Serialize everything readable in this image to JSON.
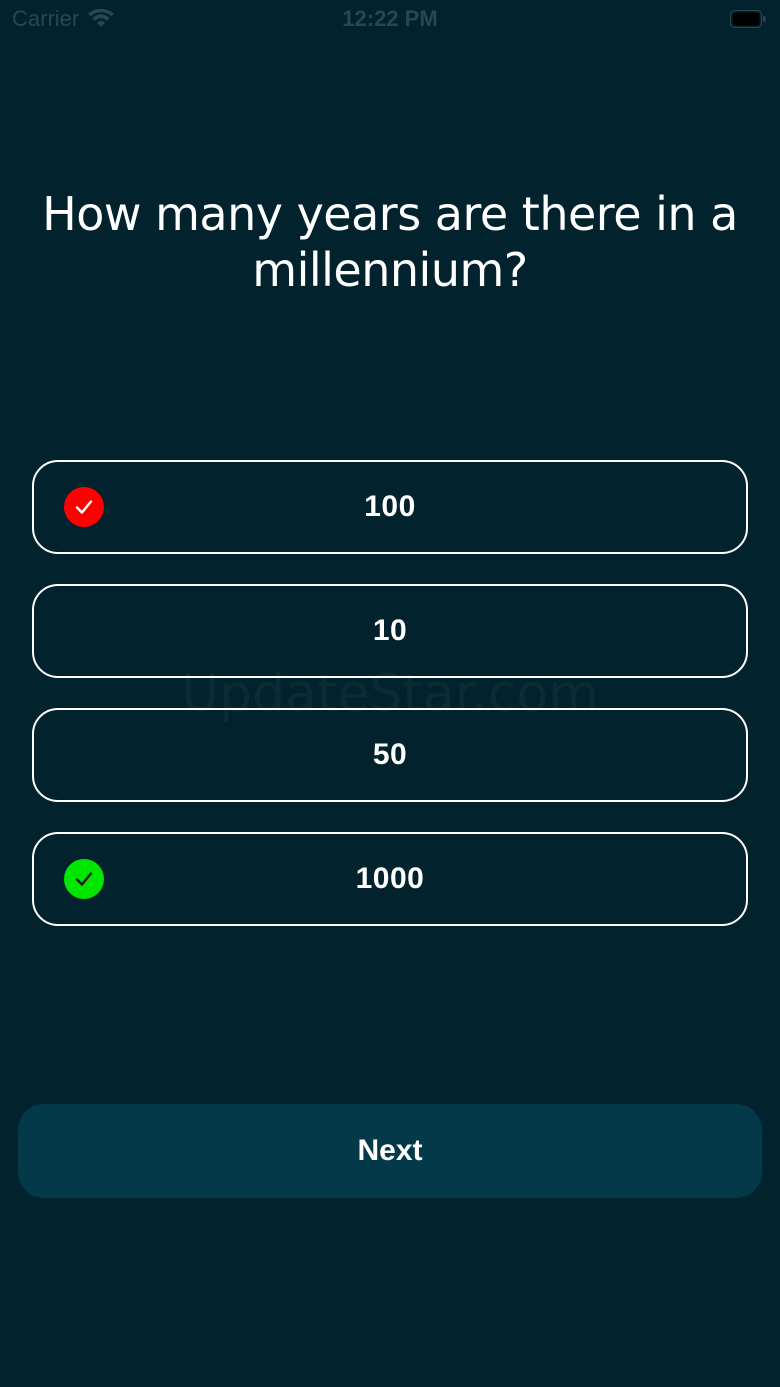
{
  "status_bar": {
    "carrier": "Carrier",
    "time": "12:22 PM",
    "wifi_icon": "wifi-icon",
    "battery_icon": "battery-icon"
  },
  "quiz": {
    "question": "How many years are there in a millennium?",
    "options": [
      {
        "label": "100",
        "mark": "wrong",
        "mark_color": "#ff0000"
      },
      {
        "label": "10",
        "mark": "none"
      },
      {
        "label": "50",
        "mark": "none"
      },
      {
        "label": "1000",
        "mark": "correct",
        "mark_color": "#00e600"
      }
    ],
    "next_label": "Next"
  },
  "watermark": "UpdateStar.com",
  "colors": {
    "background": "#02232d",
    "button": "#033949",
    "text": "#ffffff",
    "wrong": "#ff0000",
    "correct": "#00e600"
  }
}
